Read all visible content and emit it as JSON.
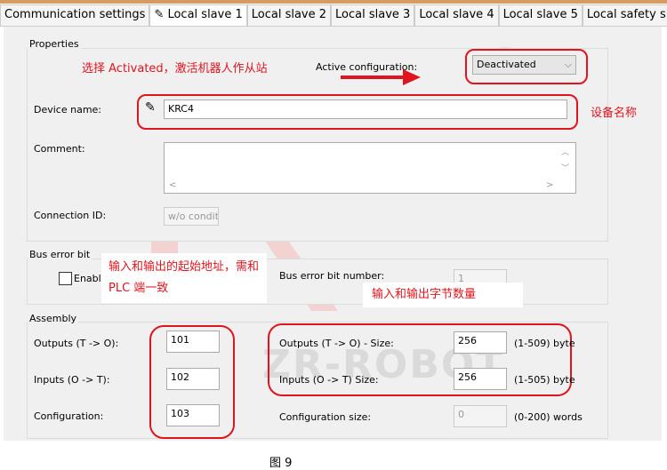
{
  "tabs": [
    {
      "label": "Communication settings"
    },
    {
      "label": "Local slave 1",
      "icon": "pencil-icon",
      "active": true
    },
    {
      "label": "Local slave 2"
    },
    {
      "label": "Local slave 3"
    },
    {
      "label": "Local slave 4"
    },
    {
      "label": "Local slave 5"
    },
    {
      "label": "Local safety slave"
    }
  ],
  "properties": {
    "title": "Properties",
    "active_config_label": "Active configuration:",
    "active_config_value": "Deactivated",
    "device_name_label": "Device name:",
    "device_name_value": "KRC4",
    "comment_label": "Comment:",
    "comment_value": "",
    "connection_id_label": "Connection ID:",
    "connection_id_value": "w/o conditi"
  },
  "bus_error": {
    "title": "Bus error bit",
    "enable_label": "Enable",
    "enable_checked": false,
    "number_label": "Bus error bit number:",
    "number_value": "1"
  },
  "assembly": {
    "title": "Assembly",
    "outputs_label": "Outputs (T -> O):",
    "outputs_value": "101",
    "inputs_label": "Inputs (O -> T):",
    "inputs_value": "102",
    "config_label": "Configuration:",
    "config_value": "103",
    "out_size_label": "Outputs (T -> O) - Size:",
    "out_size_value": "256",
    "out_size_range": "(1-509) byte",
    "in_size_label": "Inputs (O -> T) Size:",
    "in_size_value": "256",
    "in_size_range": "(1-505) byte",
    "config_size_label": "Configuration size:",
    "config_size_value": "0",
    "config_size_range": "(0-200) words"
  },
  "annotations": {
    "select_note": "选择 Activated，激活机器人作从站",
    "device_note": "设备名称",
    "address_note": "输入和输出的起始地址，需和 PLC 端一致",
    "size_note": "输入和输出字节数量"
  },
  "watermark": "ZR-ROBOT",
  "caption": "图 9",
  "colors": {
    "annotation": "#e0141e",
    "panel": "#f0f0f0",
    "tab_top": "#d79a62"
  }
}
